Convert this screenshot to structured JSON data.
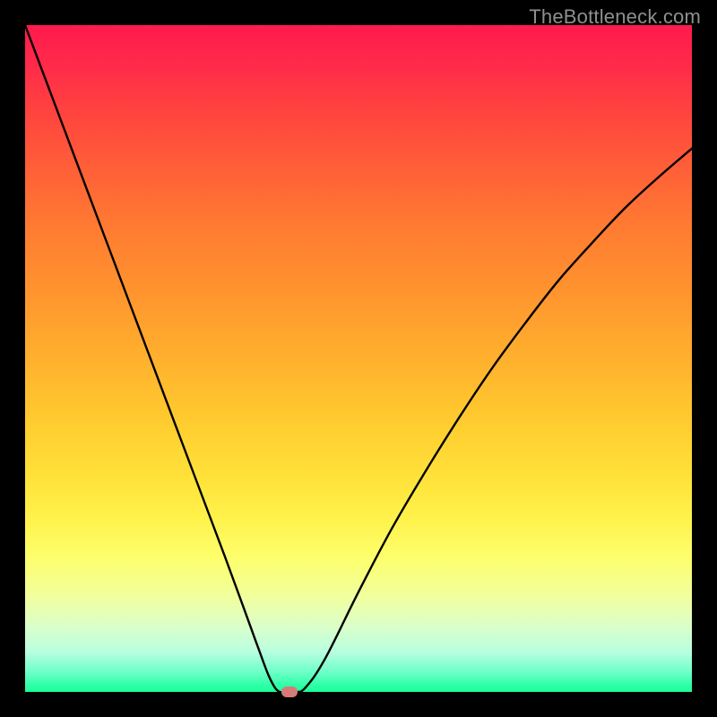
{
  "watermark": "TheBottleneck.com",
  "chart_data": {
    "type": "line",
    "title": "",
    "xlabel": "",
    "ylabel": "",
    "xlim": [
      0,
      100
    ],
    "ylim": [
      0,
      100
    ],
    "series": [
      {
        "name": "bottleneck-curve",
        "x": [
          0,
          5,
          10,
          15,
          20,
          25,
          30,
          33,
          35,
          36.5,
          37.5,
          38.2,
          38.8,
          40.5,
          42,
          45,
          50,
          55,
          60,
          65,
          70,
          75,
          80,
          85,
          90,
          95,
          100
        ],
        "y": [
          100,
          86.7,
          73.4,
          60.1,
          46.8,
          33.5,
          20.2,
          12.0,
          6.5,
          2.5,
          0.6,
          0.0,
          0.0,
          0.0,
          0.6,
          5.0,
          15.0,
          24.5,
          33.0,
          41.0,
          48.5,
          55.3,
          61.7,
          67.3,
          72.6,
          77.2,
          81.5
        ]
      }
    ],
    "marker": {
      "x": 39.6,
      "y": 0
    },
    "gradient_description": "vertical red-to-green (bottleneck severity)",
    "background_color": "#000000"
  }
}
